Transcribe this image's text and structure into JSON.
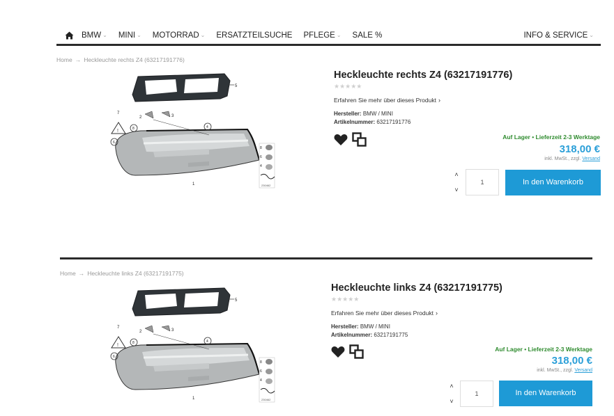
{
  "nav": {
    "items": [
      {
        "label": "BMW",
        "chevron": true
      },
      {
        "label": "MINI",
        "chevron": true
      },
      {
        "label": "MOTORRAD",
        "chevron": true
      },
      {
        "label": "ERSATZTEILSUCHE",
        "chevron": false
      },
      {
        "label": "PFLEGE",
        "chevron": true
      },
      {
        "label": "SALE %",
        "chevron": false
      }
    ],
    "info_label": "INFO & SERVICE",
    "chevron_char": "⌄"
  },
  "products": [
    {
      "breadcrumb": {
        "home": "Home",
        "current": "Heckleuchte rechts Z4 (63217191776)"
      },
      "title": "Heckleuchte rechts Z4 (63217191776)",
      "rating_stars": "★★★★★",
      "learn_more": "Erfahren Sie mehr über dieses Produkt",
      "manufacturer_label": "Hersteller:",
      "manufacturer_value": "BMW / MINI",
      "article_label": "Artikelnummer:",
      "article_value": "63217191776",
      "stock": "Auf Lager • Lieferzeit 2-3 Werktage",
      "price": "318,00 €",
      "tax_prefix": "inkl. MwSt., zzgl.",
      "tax_link": "Versand",
      "qty": "1",
      "cart_label": "In den Warenkorb",
      "diagram_code": "230462"
    },
    {
      "breadcrumb": {
        "home": "Home",
        "current": "Heckleuchte links Z4 (63217191775)"
      },
      "title": "Heckleuchte links Z4 (63217191775)",
      "rating_stars": "★★★★★",
      "learn_more": "Erfahren Sie mehr über dieses Produkt",
      "manufacturer_label": "Hersteller:",
      "manufacturer_value": "BMW / MINI",
      "article_label": "Artikelnummer:",
      "article_value": "63217191775",
      "stock": "Auf Lager • Lieferzeit 2-3 Werktage",
      "price": "318,00 €",
      "tax_prefix": "inkl. MwSt., zzgl.",
      "tax_link": "Versand",
      "qty": "1",
      "cart_label": "In den Warenkorb",
      "diagram_code": "230462"
    }
  ],
  "colors": {
    "accent": "#1e9ad6",
    "price": "#2b9fd8",
    "stock": "#2e8b2e",
    "nav_border": "#2b2b2b"
  },
  "icons": [
    "home-icon",
    "heart-icon",
    "compare-icon",
    "chevron-up-icon",
    "chevron-down-icon",
    "arrow-right-icon"
  ]
}
